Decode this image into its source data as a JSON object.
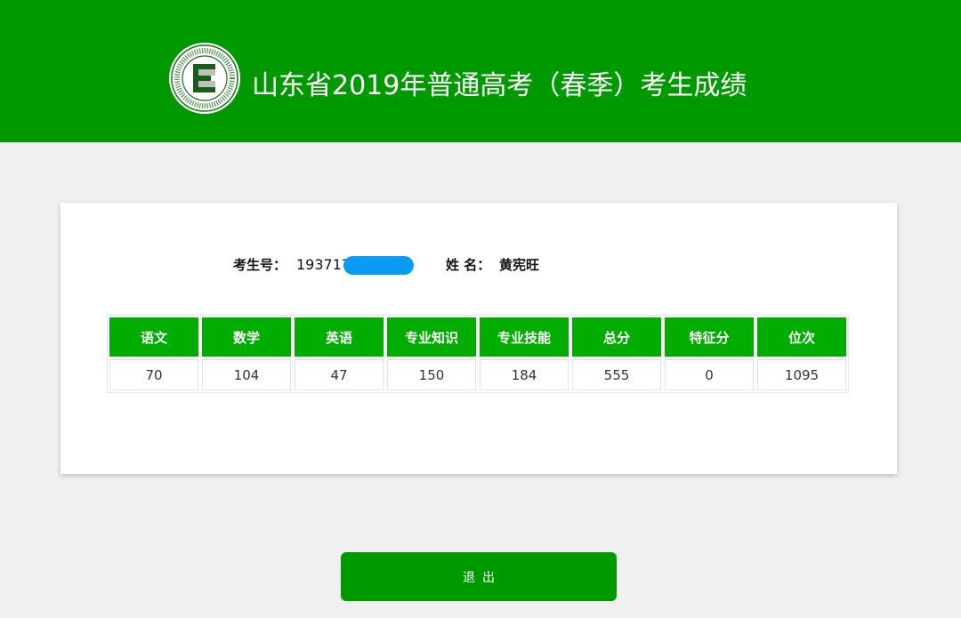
{
  "header": {
    "title": "山东省2019年普通高考（春季）考生成绩",
    "logo_icon": "shandong-education-admissions-seal-icon",
    "background_color": "#009a00"
  },
  "student": {
    "id_label": "考生号：",
    "id_value": "193717",
    "id_masked": true,
    "name_label": "姓 名：",
    "name_value": "黄宪旺"
  },
  "scores": {
    "headers": [
      "语文",
      "数学",
      "英语",
      "专业知识",
      "专业技能",
      "总分",
      "特征分",
      "位次"
    ],
    "values": [
      "70",
      "104",
      "47",
      "150",
      "184",
      "555",
      "0",
      "1095"
    ],
    "header_color": "#00ad00"
  },
  "actions": {
    "exit_label": "退出"
  },
  "colors": {
    "mask": "#0a9cf5",
    "page_background": "#f0f0f0"
  }
}
